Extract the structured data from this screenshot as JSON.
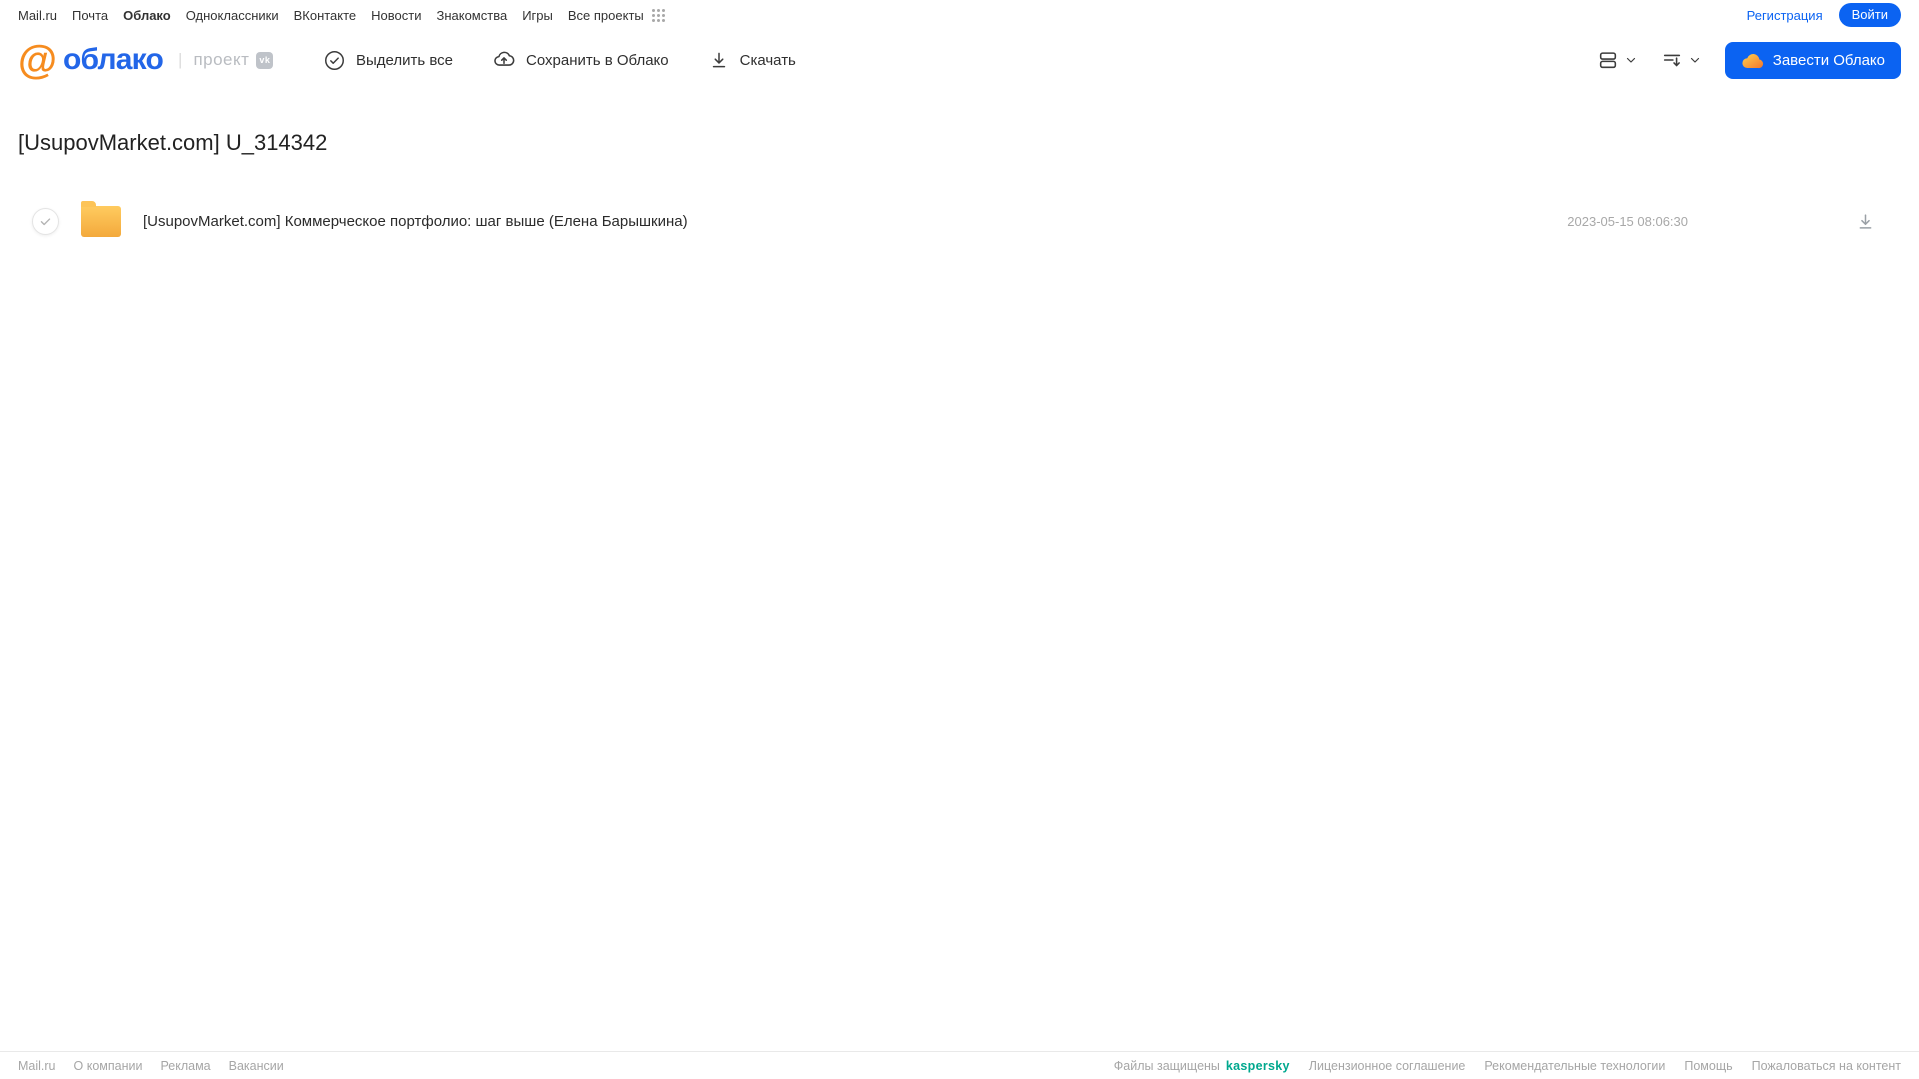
{
  "top_nav": {
    "links": [
      {
        "label": "Mail.ru"
      },
      {
        "label": "Почта"
      },
      {
        "label": "Облако"
      },
      {
        "label": "Одноклассники"
      },
      {
        "label": "ВКонтакте"
      },
      {
        "label": "Новости"
      },
      {
        "label": "Знакомства"
      },
      {
        "label": "Игры"
      },
      {
        "label": "Все проекты"
      }
    ],
    "active_link": "Облако",
    "register_label": "Регистрация",
    "login_label": "Войти"
  },
  "header": {
    "logo": {
      "at": "@",
      "text": "облако",
      "divider": "|",
      "project": "проект",
      "vk_badge": "vk"
    },
    "toolbar": {
      "select_all": "Выделить все",
      "save_to_cloud": "Сохранить в Облако",
      "download": "Скачать"
    },
    "create_cloud_button": "Завести Облако"
  },
  "main": {
    "title": "[UsupovMarket.com] U_314342",
    "files": [
      {
        "type": "folder",
        "name": "[UsupovMarket.com] Коммерческое портфолио: шаг выше (Елена Барышкина)",
        "date": "2023-05-15 08:06:30"
      }
    ]
  },
  "footer": {
    "left_links": [
      "Mail.ru",
      "О компании",
      "Реклама",
      "Вакансии"
    ],
    "protected_label": "Файлы защищены",
    "kaspersky_label": "kaspersky",
    "right_links": [
      "Лицензионное соглашение",
      "Рекомендательные технологии",
      "Помощь",
      "Пожаловаться на контент"
    ]
  },
  "icons": {
    "apps_grid": "grid-dots-icon",
    "select_all": "check-circle-icon",
    "save_to_cloud": "cloud-upload-icon",
    "download": "download-icon",
    "view_mode": "list-view-icon",
    "sort": "sort-icon",
    "chevron": "chevron-down-icon",
    "create_cloud": "cloud-icon",
    "folder": "folder-icon",
    "row_download": "download-icon"
  },
  "colors": {
    "accent_blue": "#0B63F2",
    "logo_orange": "#F68C1F",
    "logo_blue": "#2366E8",
    "folder_yellow": "#F5B445",
    "kaspersky_green": "#00A88E",
    "footer_gray": "#A6A6A6"
  }
}
